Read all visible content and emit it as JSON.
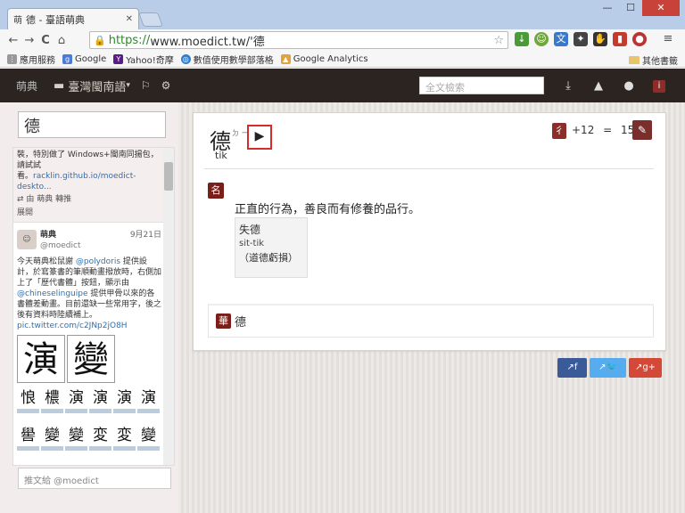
{
  "tab": {
    "favicon": "萌",
    "title": "德 - 臺語萌典",
    "close": "✕"
  },
  "window": {
    "minimize": "—",
    "maximize": "☐",
    "close": "✕"
  },
  "address": {
    "https": "https://",
    "rest": "www.moedict.tw/'德",
    "lock": "🔒",
    "star": "☆"
  },
  "nav": {
    "back": "←",
    "forward": "→",
    "reload": "C",
    "home": "⌂",
    "menu": "≡"
  },
  "bookmarks": {
    "items": [
      {
        "label": "應用服務",
        "color": "#999"
      },
      {
        "label": "Google",
        "color": "#4a7bd8"
      },
      {
        "label": "Yahoo!奇摩",
        "color": "#5a1d87"
      },
      {
        "label": "數值使用數學部落格",
        "color": "#2d7fd0"
      },
      {
        "label": "Google Analytics",
        "color": "#e6a23a"
      }
    ],
    "other": "其他書籤"
  },
  "navbar": {
    "brand": "萌典",
    "dict": "臺灣閩南語",
    "caret": "▾",
    "search_placeholder": "全文檢索"
  },
  "sidebar": {
    "query": "德",
    "tweet1": {
      "text": "裝，特別做了 Windows+閩南同揚包，請試試",
      "prefix": "看。",
      "link": "racklin.github.io/moedict-deskto...",
      "meta": "由 萌典 轉推",
      "more": "展開"
    },
    "tweet2": {
      "name": "萌典",
      "handle": "@moedict",
      "date": "9月21日",
      "body1": "今天萌典松鼠謝 ",
      "mention1": "@polydoris",
      "body2": " 提供設計，於寫篆書的筆順動畫撥放時，右側加上了「歷代書體」按鈕，顯示由 ",
      "mention2": "@chineselinguipe",
      "body3": " 提供甲骨以來的各書體差動畫。目前還缺一些常用字，後之後有資料時陸續補上。",
      "link": "pic.twitter.com/c2JNp2jO8H"
    },
    "pic_big": [
      "演",
      "變"
    ],
    "pic_row1": [
      "悢",
      "檂",
      "演",
      "演",
      "演",
      "演"
    ],
    "pic_row2": [
      "嚳",
      "變",
      "變",
      "変",
      "変",
      "變"
    ],
    "compose_placeholder": "推文給 @moedict"
  },
  "entry": {
    "char": "德",
    "bopomofo": "ㄉ\nㄧ",
    "romanization": "tik",
    "play": "▶",
    "radical": "彳",
    "stroke_extra": "+12",
    "equals": "=",
    "stroke_total": "15",
    "edit": "✎",
    "pos": "名",
    "definition": "正直的行為，善良而有修養的品行。",
    "example": {
      "char": "失德",
      "rom": "sit-tik",
      "note": "（道德虧損）"
    },
    "hua_tag": "華",
    "hua_text": "德"
  },
  "share": {
    "fb": "f",
    "tw": "🐦",
    "gp": "g+",
    "prefix": "↗"
  }
}
